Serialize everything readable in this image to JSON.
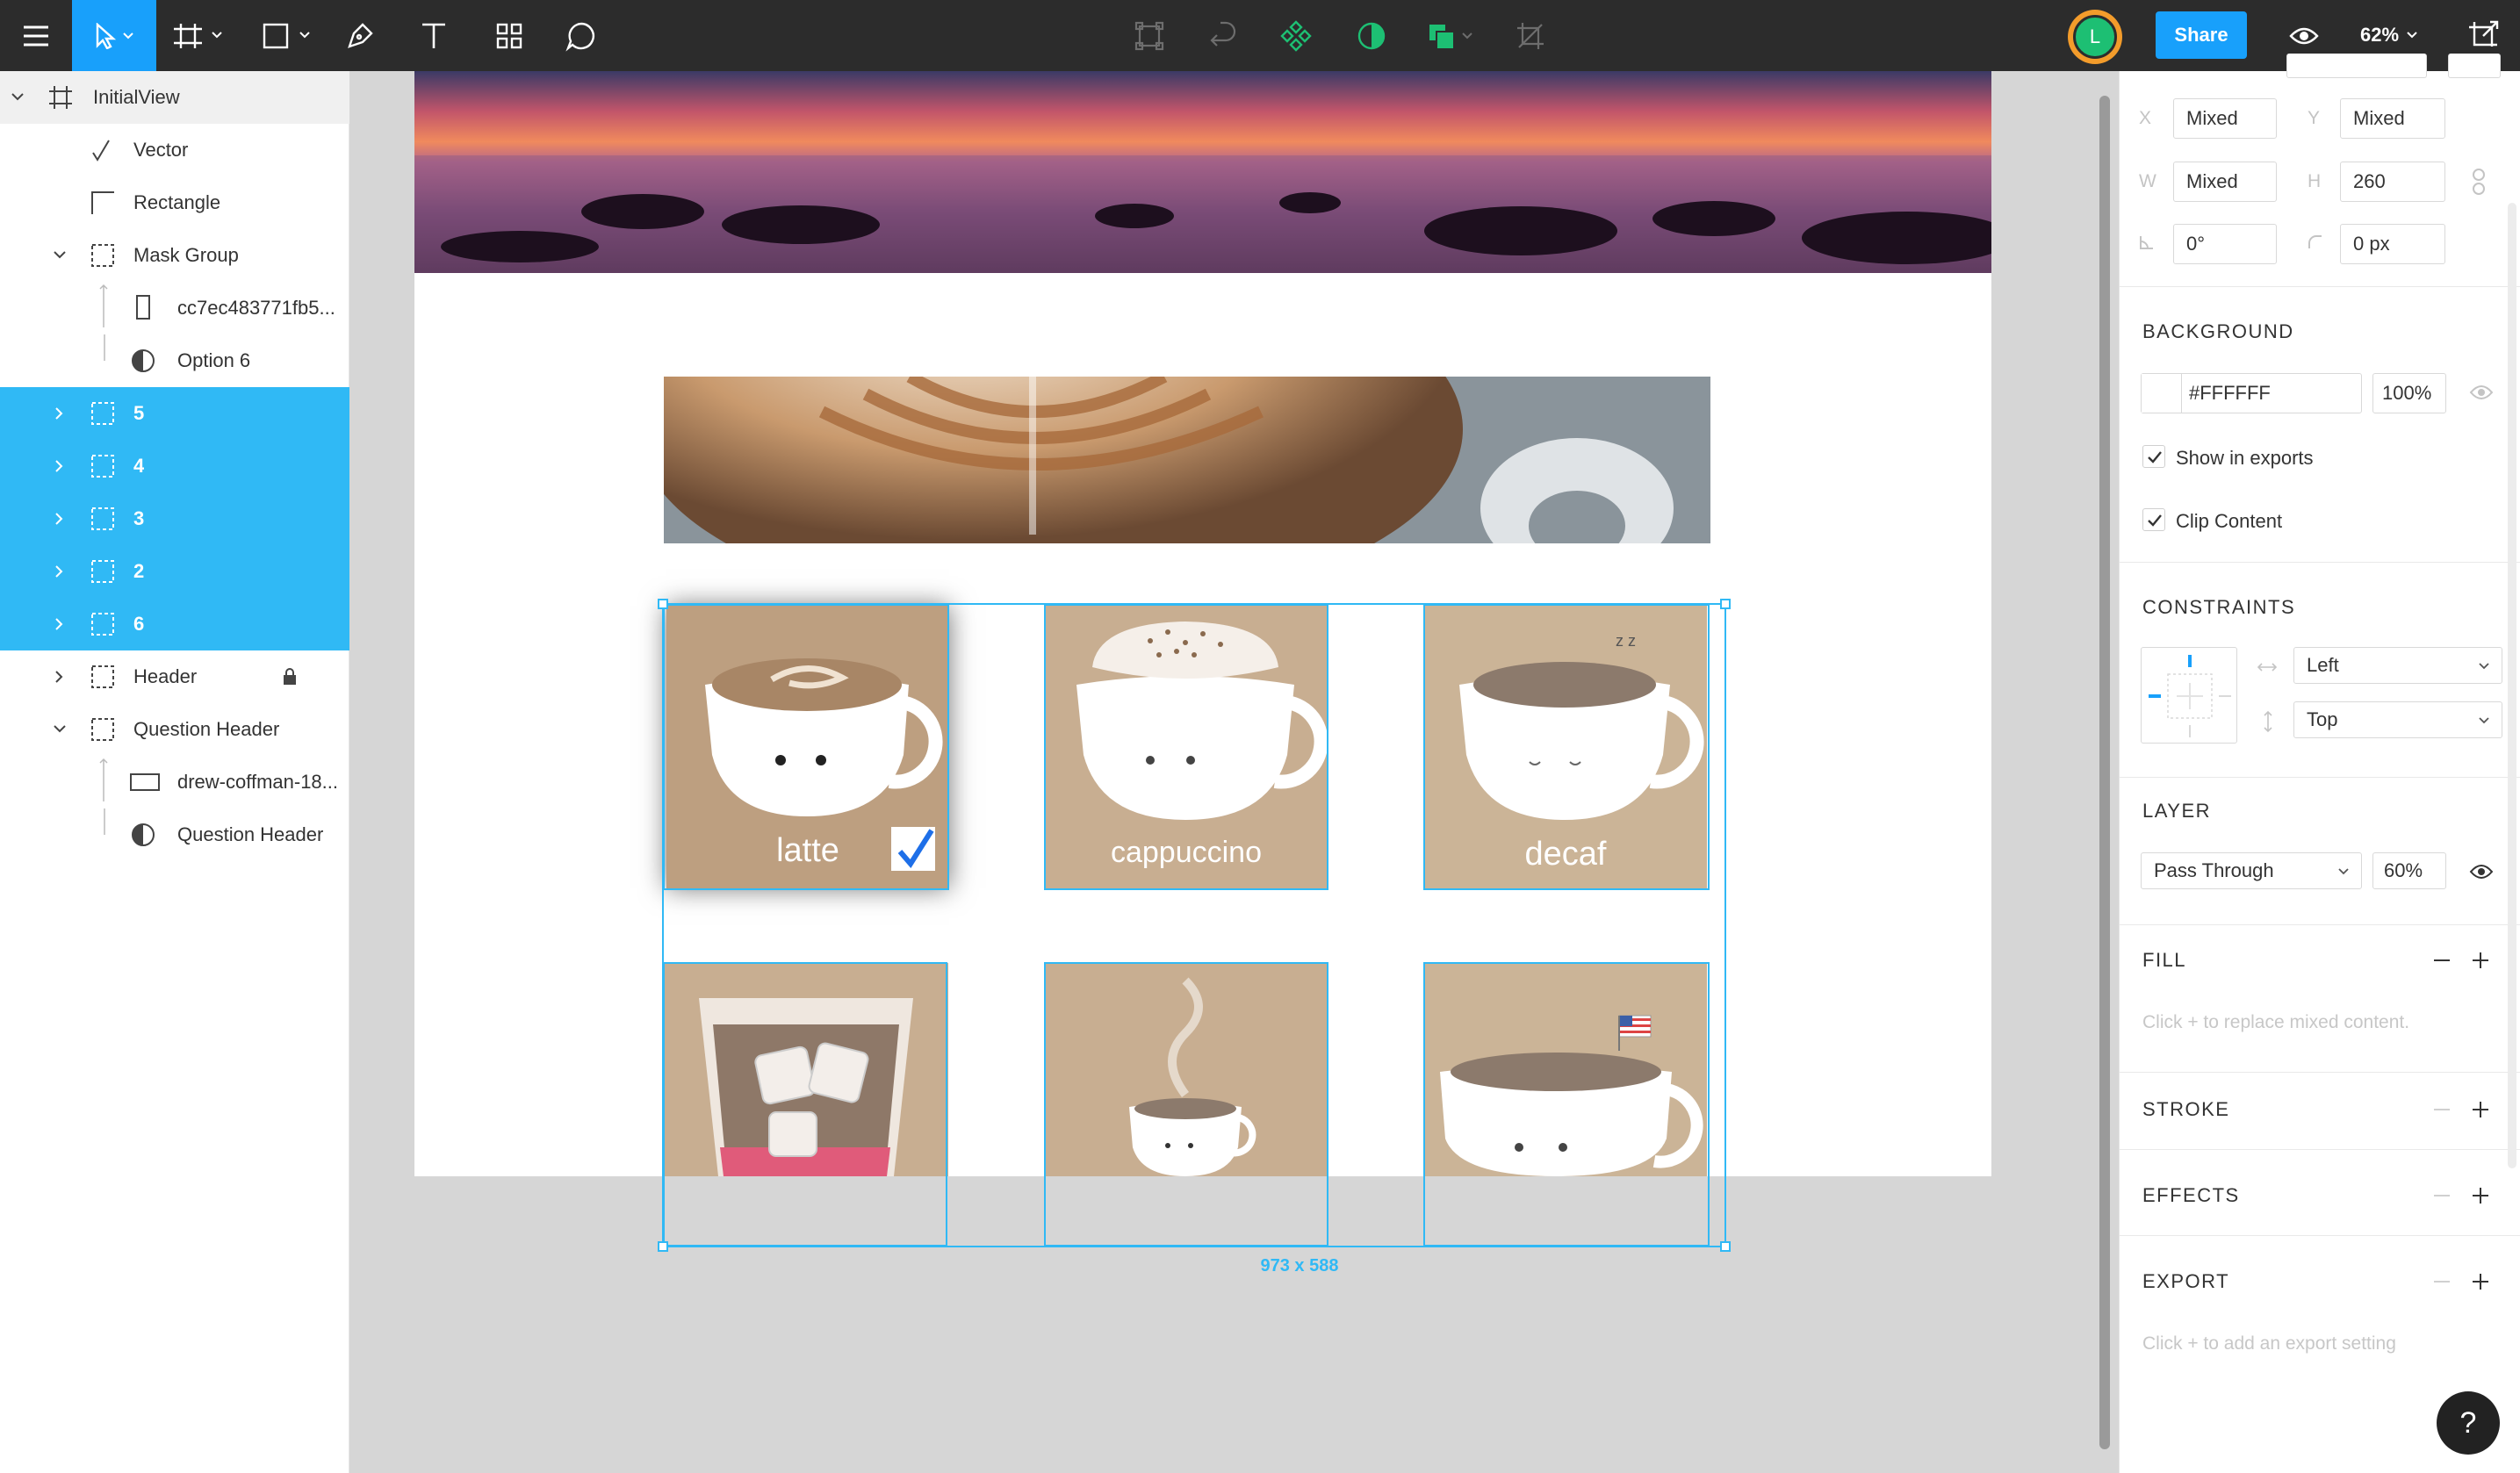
{
  "toolbar": {
    "share_label": "Share",
    "avatar_initial": "L",
    "zoom_label": "62%",
    "icons": [
      "menu-icon",
      "move-tool-icon",
      "frame-tool-icon",
      "shape-tool-icon",
      "pen-tool-icon",
      "text-tool-icon",
      "components-icon",
      "comment-icon",
      "boolean-icon",
      "flip-icon",
      "create-component-icon",
      "mask-icon",
      "fill-color-icon",
      "crop-icon",
      "preview-eye-icon",
      "present-icon"
    ]
  },
  "layers": [
    {
      "label": "InitialView",
      "icon": "frame-icon",
      "selected": false,
      "expanded": true
    },
    {
      "label": "Vector",
      "icon": "vector-icon",
      "selected": false
    },
    {
      "label": "Rectangle",
      "icon": "rectangle-icon",
      "selected": false
    },
    {
      "label": "Mask Group",
      "icon": "group-icon",
      "selected": false,
      "expanded": true
    },
    {
      "label": "cc7ec483771fb5...",
      "icon": "rectangle-portrait-icon",
      "selected": false
    },
    {
      "label": "Option 6",
      "icon": "mask-icon",
      "selected": false
    },
    {
      "label": "5",
      "icon": "group-icon",
      "selected": true
    },
    {
      "label": "4",
      "icon": "group-icon",
      "selected": true
    },
    {
      "label": "3",
      "icon": "group-icon",
      "selected": true
    },
    {
      "label": "2",
      "icon": "group-icon",
      "selected": true
    },
    {
      "label": "6",
      "icon": "group-icon",
      "selected": true
    },
    {
      "label": "Header",
      "icon": "group-icon",
      "selected": false,
      "locked": true
    },
    {
      "label": "Question Header",
      "icon": "group-icon",
      "selected": false,
      "expanded": true
    },
    {
      "label": "drew-coffman-18...",
      "icon": "rectangle-landscape-icon",
      "selected": false
    },
    {
      "label": "Question Header",
      "icon": "mask-icon",
      "selected": false
    }
  ],
  "canvas": {
    "cards": [
      {
        "label": "latte",
        "checked": true
      },
      {
        "label": "cappuccino",
        "checked": false
      },
      {
        "label": "decaf",
        "checked": false
      },
      {
        "label": "",
        "checked": false
      },
      {
        "label": "",
        "checked": false
      },
      {
        "label": "",
        "checked": false
      }
    ],
    "selection_size": "973 x 588"
  },
  "properties": {
    "x_label": "X",
    "x_value": "Mixed",
    "y_label": "Y",
    "y_value": "Mixed",
    "w_label": "W",
    "w_value": "Mixed",
    "h_label": "H",
    "h_value": "260",
    "rotation_value": "0°",
    "radius_value": "0 px",
    "background": {
      "title": "BACKGROUND",
      "color": "#FFFFFF",
      "opacity": "100%",
      "show_in_exports": "Show in exports",
      "clip_content": "Clip Content"
    },
    "constraints": {
      "title": "CONSTRAINTS",
      "horizontal": "Left",
      "vertical": "Top"
    },
    "layer": {
      "title": "LAYER",
      "blend_mode": "Pass Through",
      "opacity": "60%"
    },
    "fill": {
      "title": "FILL",
      "hint": "Click + to replace mixed content."
    },
    "stroke": {
      "title": "STROKE"
    },
    "effects": {
      "title": "EFFECTS"
    },
    "export": {
      "title": "EXPORT",
      "hint": "Click + to add an export setting"
    }
  },
  "colors": {
    "accent": "#18a0fb",
    "selection": "#30b9f5",
    "toolbar": "#2c2c2c",
    "avatar_ring": "#f39c2b",
    "avatar_fill": "#1dbf73"
  }
}
